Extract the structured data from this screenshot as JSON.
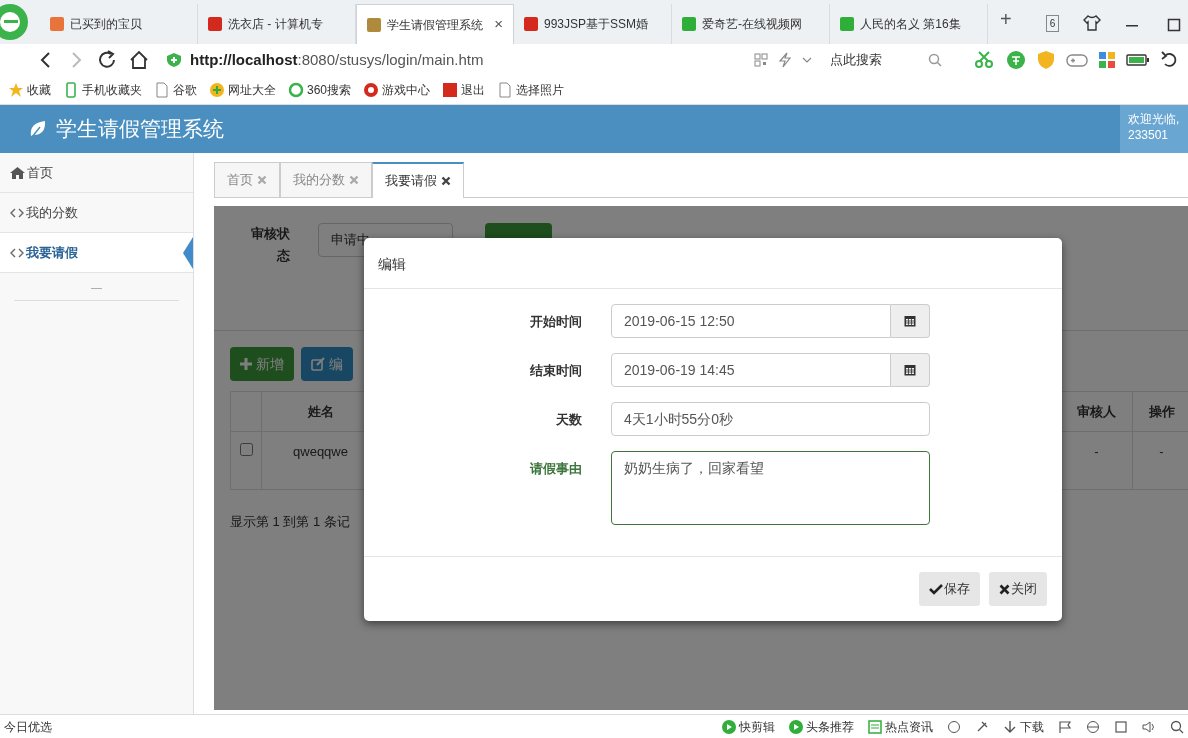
{
  "browser": {
    "tabs": [
      {
        "title": "已买到的宝贝",
        "color": "#e8743b",
        "selected": false
      },
      {
        "title": "洗衣店 - 计算机专",
        "color": "#d42a1e",
        "selected": false
      },
      {
        "title": "学生请假管理系统",
        "color": "#b08a3c",
        "selected": true,
        "close": "×"
      },
      {
        "title": "993JSP基于SSM婚",
        "color": "#d42a1e",
        "selected": false
      },
      {
        "title": "爱奇艺-在线视频网",
        "color": "#2fae3a",
        "selected": false
      },
      {
        "title": "人民的名义 第16集",
        "color": "#2fae3a",
        "selected": false
      }
    ],
    "new_tab": "+",
    "tab_count": "6",
    "url_host": "http://localhost",
    "url_rest": ":8080/stusys/login/main.htm",
    "search_placeholder": "点此搜索",
    "bookmarks": [
      {
        "label": "收藏",
        "kind": "star"
      },
      {
        "label": "手机收藏夹",
        "kind": "phone"
      },
      {
        "label": "谷歌",
        "kind": "page"
      },
      {
        "label": "网址大全",
        "kind": "globe"
      },
      {
        "label": "360搜索",
        "kind": "ring"
      },
      {
        "label": "游戏中心",
        "kind": "game"
      },
      {
        "label": "退出",
        "kind": "square"
      },
      {
        "label": "选择照片",
        "kind": "page"
      }
    ]
  },
  "app": {
    "title": "学生请假管理系统",
    "welcome": "欢迎光临,",
    "user": "233501"
  },
  "sidebar": {
    "items": [
      {
        "label": "首页",
        "kind": "home",
        "selected": false
      },
      {
        "label": "我的分数",
        "kind": "link",
        "selected": false
      },
      {
        "label": "我要请假",
        "kind": "link",
        "selected": true
      }
    ],
    "collapse": "—"
  },
  "content_tabs": [
    {
      "label": "首页",
      "selected": false
    },
    {
      "label": "我的分数",
      "selected": false
    },
    {
      "label": "我要请假",
      "selected": true
    }
  ],
  "filter": {
    "label": "审核状态",
    "value": "申请中"
  },
  "toolbar": [
    {
      "label": "新增",
      "kind": "add"
    },
    {
      "label": "编",
      "kind": "edit"
    }
  ],
  "table": {
    "columns": [
      "姓名",
      "审核人",
      "操作"
    ],
    "rows": [
      {
        "checked": false,
        "cells": [
          "qweqqwe",
          "-",
          "-"
        ]
      }
    ]
  },
  "pagination": "显示第 1 到第 1 条记",
  "modal": {
    "title": "编辑",
    "fields": [
      {
        "label": "开始时间",
        "kind": "datetime",
        "value": "2019-06-15 12:50",
        "validated": false
      },
      {
        "label": "结束时间",
        "kind": "datetime",
        "value": "2019-06-19 14:45",
        "validated": false
      },
      {
        "label": "天数",
        "kind": "text",
        "value": "4天1小时55分0秒",
        "validated": false
      },
      {
        "label": "请假事由",
        "kind": "textarea",
        "value": "奶奶生病了，回家看望",
        "validated": true
      }
    ],
    "buttons": [
      {
        "label": "保存",
        "kind": "save"
      },
      {
        "label": "关闭",
        "kind": "close"
      }
    ]
  },
  "status_bar": {
    "left": "今日优选",
    "items": [
      {
        "label": "快剪辑",
        "kind": "play"
      },
      {
        "label": "头条推荐",
        "kind": "play"
      },
      {
        "label": "热点资讯",
        "kind": "news"
      },
      {
        "label": "下载",
        "kind": "download"
      }
    ]
  }
}
